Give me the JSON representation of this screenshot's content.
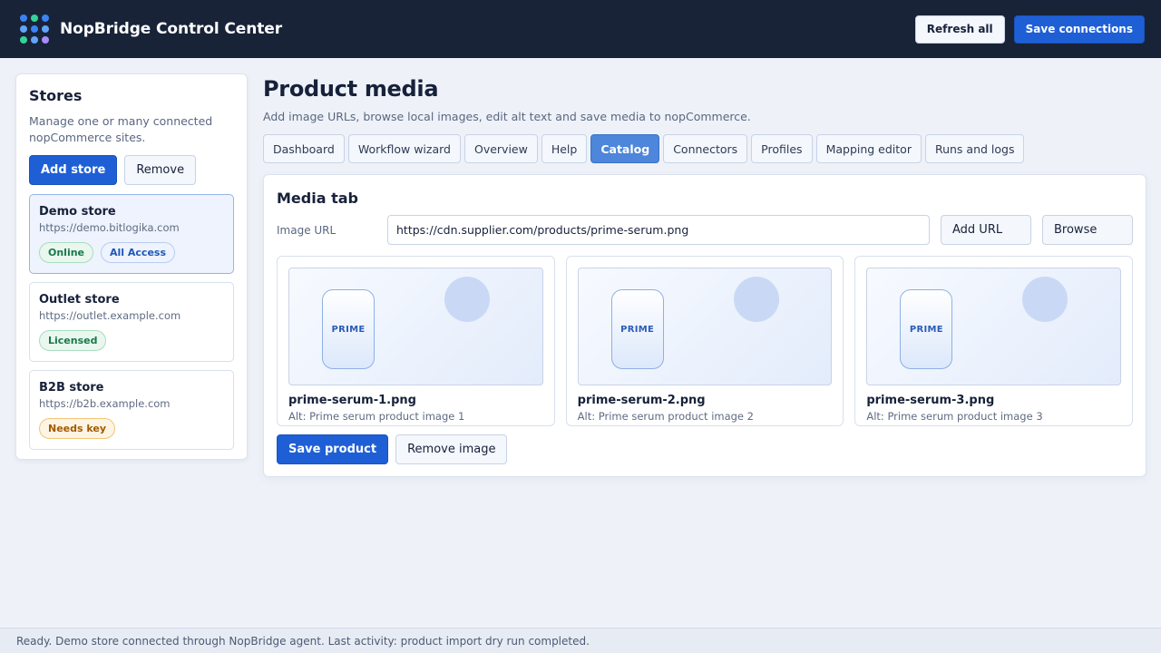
{
  "app": {
    "title": "NopBridge Control Center",
    "logo_dot_colors": [
      "#3b82f6",
      "#34d399",
      "#3b82f6",
      "#60a5fa",
      "#3b82f6",
      "#60a5fa",
      "#34d399",
      "#60a5fa",
      "#a78bfa"
    ]
  },
  "topbar": {
    "refresh_label": "Refresh all",
    "save_label": "Save connections"
  },
  "sidebar": {
    "title": "Stores",
    "description": "Manage one or many connected nopCommerce sites.",
    "add_label": "Add store",
    "remove_label": "Remove",
    "stores": [
      {
        "name": "Demo store",
        "url": "https://demo.bitlogika.com",
        "badges": [
          "Online",
          "All Access"
        ],
        "selected": true
      },
      {
        "name": "Outlet store",
        "url": "https://outlet.example.com",
        "badges": [
          "Licensed"
        ],
        "selected": false
      },
      {
        "name": "B2B store",
        "url": "https://b2b.example.com",
        "badges": [
          "Needs key"
        ],
        "selected": false
      }
    ]
  },
  "main": {
    "title": "Product media",
    "subtitle": "Add image URLs, browse local images, edit alt text and save media to nopCommerce.",
    "tabs": [
      "Dashboard",
      "Workflow wizard",
      "Overview",
      "Help",
      "Catalog",
      "Connectors",
      "Profiles",
      "Mapping editor",
      "Runs and logs"
    ],
    "active_tab": "Catalog"
  },
  "media": {
    "heading": "Media tab",
    "url_label": "Image URL",
    "url_value": "https://cdn.supplier.com/products/prime-serum.png",
    "add_url_label": "Add URL",
    "browse_label": "Browse",
    "images": [
      {
        "file": "prime-serum-1.png",
        "alt": "Alt: Prime serum product image 1",
        "brand": "PRIME"
      },
      {
        "file": "prime-serum-2.png",
        "alt": "Alt: Prime serum product image 2",
        "brand": "PRIME"
      },
      {
        "file": "prime-serum-3.png",
        "alt": "Alt: Prime serum product image 3",
        "brand": "PRIME"
      }
    ],
    "save_label": "Save product",
    "remove_label": "Remove image"
  },
  "status": {
    "text": "Ready. Demo store connected through NopBridge agent. Last activity: product import dry run completed."
  }
}
